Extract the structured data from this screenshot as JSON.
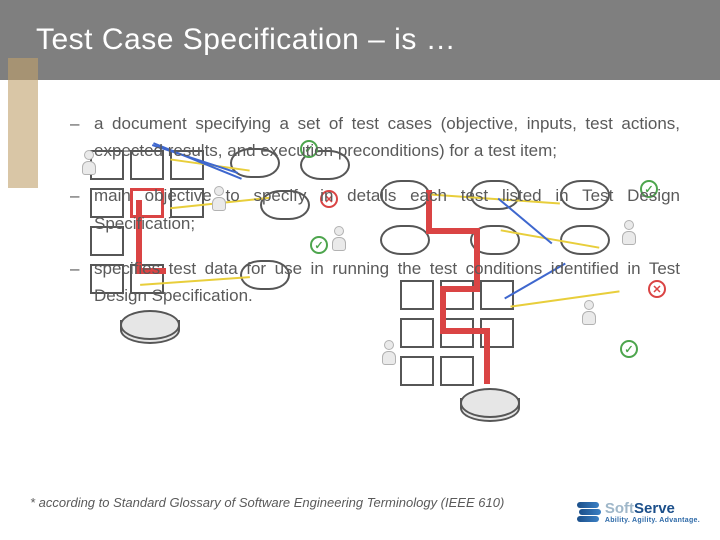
{
  "header": {
    "title": "Test Case Specification – is …"
  },
  "bullets": [
    "a document specifying a set of test cases (objective, inputs, test actions, expected results, and execution preconditions) for a test item;",
    "main objective to specify in details each test listed in Test Design Specification;",
    "specifies test data for use in running the test conditions identified in Test Design Specification."
  ],
  "footnote": "* according to Standard Glossary of Software Engineering Terminology (IEEE 610)",
  "logo": {
    "name_a": "Soft",
    "name_b": "Serve",
    "tagline": "Ability. Agility. Advantage."
  }
}
